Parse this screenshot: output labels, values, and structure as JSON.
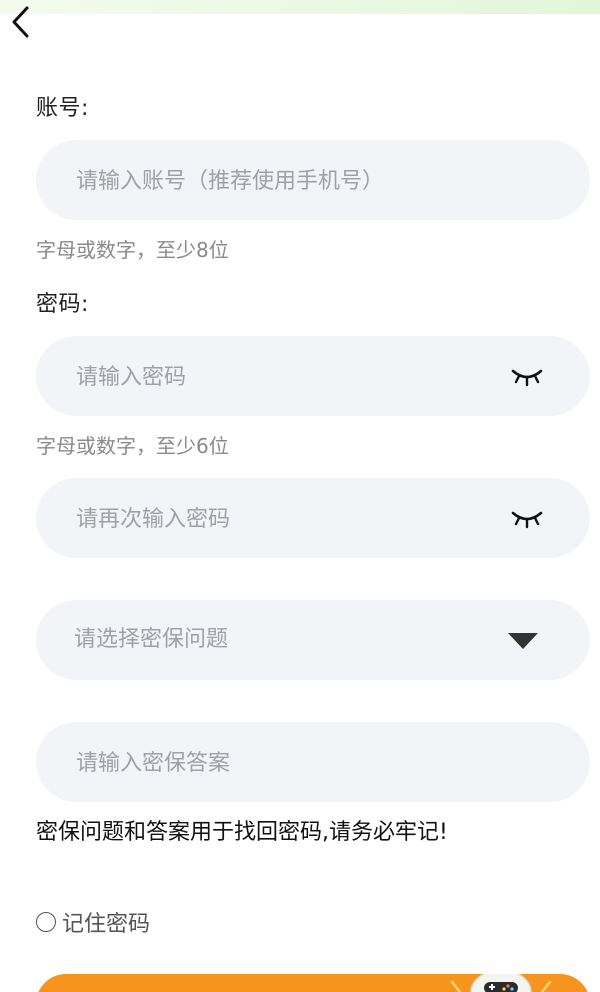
{
  "nav": {
    "back_icon": "chevron-left-icon"
  },
  "account": {
    "label": "账号:",
    "placeholder": "请输入账号（推荐使用手机号）",
    "hint": "字母或数字，至少8位"
  },
  "password": {
    "label": "密码:",
    "placeholder": "请输入密码",
    "visibility_icon": "eye-closed-icon",
    "hint": "字母或数字，至少6位"
  },
  "confirm_password": {
    "placeholder": "请再次输入密码",
    "visibility_icon": "eye-closed-icon"
  },
  "security_question": {
    "placeholder": "请选择密保问题",
    "dropdown_icon": "triangle-down-icon"
  },
  "security_answer": {
    "placeholder": "请输入密保答案"
  },
  "notice": "密保问题和答案用于找回密码,请务必牢记!",
  "remember": {
    "label": "记住密码",
    "checked": false
  },
  "submit": {
    "mascot_icon": "game-controller-mascot-icon"
  },
  "colors": {
    "accent": "#f7941d",
    "field_bg": "#f3f4f8",
    "hint_text": "#8a8a8a",
    "placeholder_text": "#a0a0a8"
  }
}
